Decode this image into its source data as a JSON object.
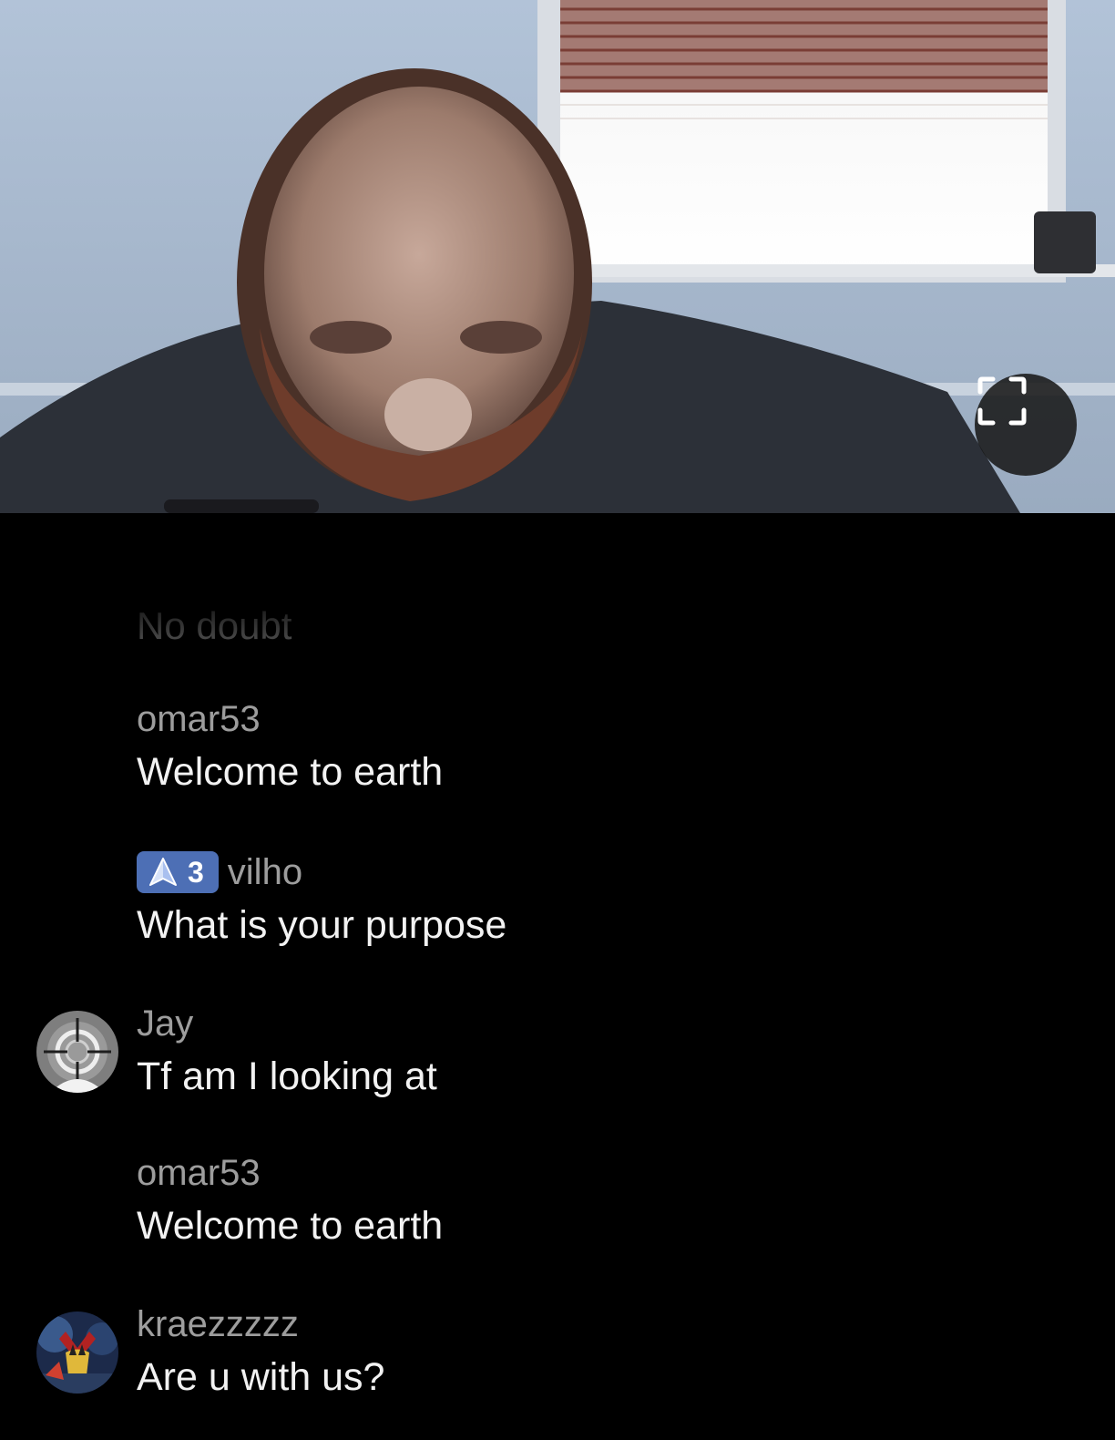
{
  "stream": {
    "fullscreen_icon": "fullscreen-icon"
  },
  "chat": {
    "messages": [
      {
        "username": "No doubt",
        "text": "No doubt",
        "avatar": "none",
        "cut": true
      },
      {
        "username": "omar53",
        "text": "Welcome to earth",
        "avatar": "none"
      },
      {
        "username": "vilho",
        "text": "What is your purpose",
        "avatar": "none",
        "badge": {
          "icon": "navigation-arrow-icon",
          "count": "3",
          "color": "#4d6fb5"
        }
      },
      {
        "username": "Jay",
        "text": "Tf am I looking at",
        "avatar": "crosshair-avatar"
      },
      {
        "username": "omar53",
        "text": "Welcome to earth",
        "avatar": "none"
      },
      {
        "username": "kraezzzzz",
        "text": "Are u with us?",
        "avatar": "superhero-avatar"
      }
    ]
  }
}
